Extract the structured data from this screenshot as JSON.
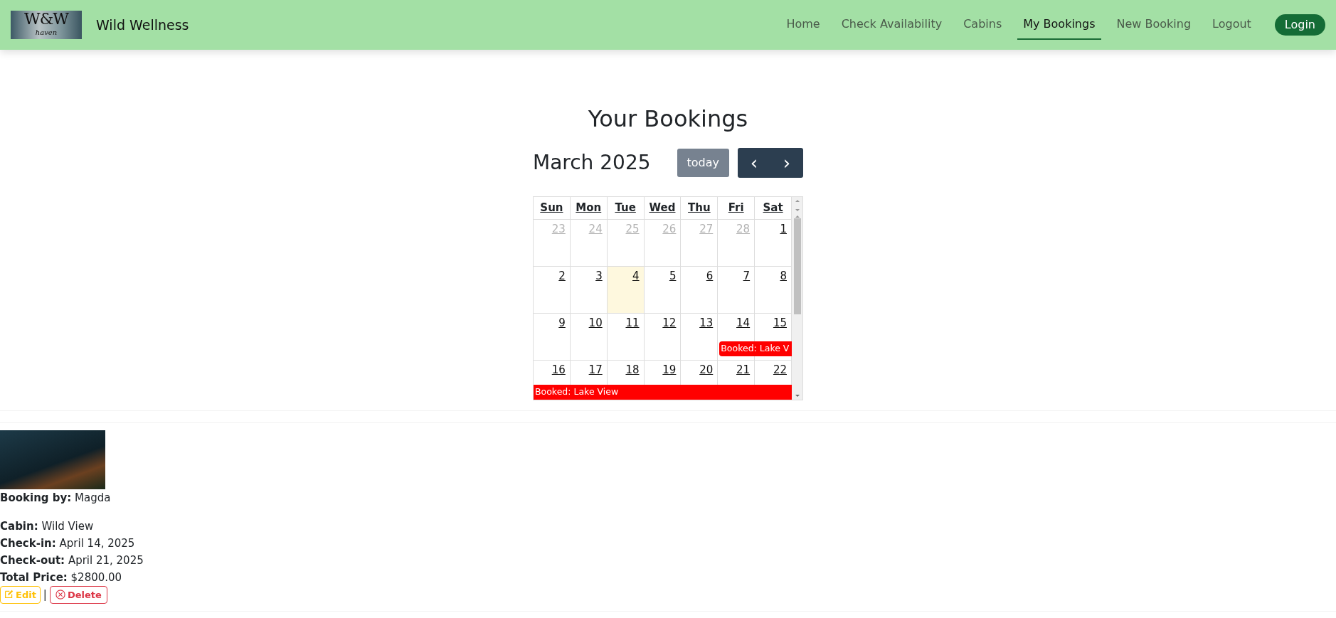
{
  "navbar": {
    "logo": {
      "text": "W&W",
      "subtext": "haven"
    },
    "brand": "Wild Wellness",
    "links": [
      {
        "label": "Home",
        "selected": false
      },
      {
        "label": "Check Availability",
        "selected": false
      },
      {
        "label": "Cabins",
        "selected": false
      },
      {
        "label": "My Bookings",
        "selected": true
      },
      {
        "label": "New Booking",
        "selected": false
      },
      {
        "label": "Logout",
        "selected": false
      }
    ],
    "login": "Login"
  },
  "page_title": "Your Bookings",
  "calendar": {
    "title": "March 2025",
    "today_button": "today",
    "prev": "‹",
    "next": "›",
    "weekdays": [
      "Sun",
      "Mon",
      "Tue",
      "Wed",
      "Thu",
      "Fri",
      "Sat"
    ],
    "weeks": [
      {
        "days": [
          {
            "num": "23",
            "other_month": true,
            "today": false
          },
          {
            "num": "24",
            "other_month": true,
            "today": false
          },
          {
            "num": "25",
            "other_month": true,
            "today": false
          },
          {
            "num": "26",
            "other_month": true,
            "today": false
          },
          {
            "num": "27",
            "other_month": true,
            "today": false
          },
          {
            "num": "28",
            "other_month": true,
            "today": false
          },
          {
            "num": "1",
            "other_month": false,
            "today": false
          }
        ]
      },
      {
        "days": [
          {
            "num": "2",
            "other_month": false,
            "today": false
          },
          {
            "num": "3",
            "other_month": false,
            "today": false
          },
          {
            "num": "4",
            "other_month": false,
            "today": true
          },
          {
            "num": "5",
            "other_month": false,
            "today": false
          },
          {
            "num": "6",
            "other_month": false,
            "today": false
          },
          {
            "num": "7",
            "other_month": false,
            "today": false
          },
          {
            "num": "8",
            "other_month": false,
            "today": false
          }
        ]
      },
      {
        "days": [
          {
            "num": "9",
            "other_month": false,
            "today": false
          },
          {
            "num": "10",
            "other_month": false,
            "today": false
          },
          {
            "num": "11",
            "other_month": false,
            "today": false
          },
          {
            "num": "12",
            "other_month": false,
            "today": false
          },
          {
            "num": "13",
            "other_month": false,
            "today": false
          },
          {
            "num": "14",
            "other_month": false,
            "today": false,
            "event": {
              "label": "Booked: Lake V",
              "continued": false,
              "continues_after": true,
              "color": "#ff0000"
            }
          },
          {
            "num": "15",
            "other_month": false,
            "today": false
          }
        ]
      },
      {
        "days": [
          {
            "num": "16",
            "other_month": false,
            "today": false,
            "event": {
              "label": "Booked: Lake View",
              "continued": true,
              "continues_after": true,
              "color": "#ff0000"
            }
          },
          {
            "num": "17",
            "other_month": false,
            "today": false
          },
          {
            "num": "18",
            "other_month": false,
            "today": false
          },
          {
            "num": "19",
            "other_month": false,
            "today": false
          },
          {
            "num": "20",
            "other_month": false,
            "today": false
          },
          {
            "num": "21",
            "other_month": false,
            "today": false
          },
          {
            "num": "22",
            "other_month": false,
            "today": false
          }
        ]
      }
    ]
  },
  "booking": {
    "lines": [
      "**Booking by:** Magda"
    ],
    "details": [
      "**Cabin:** Wild View",
      "**Check-in:** April 14, 2025",
      "**Check-out:** April 21, 2025",
      "**Total Price:** $2800.00"
    ],
    "edit": "Edit",
    "separator": "|",
    "delete": "Delete"
  }
}
